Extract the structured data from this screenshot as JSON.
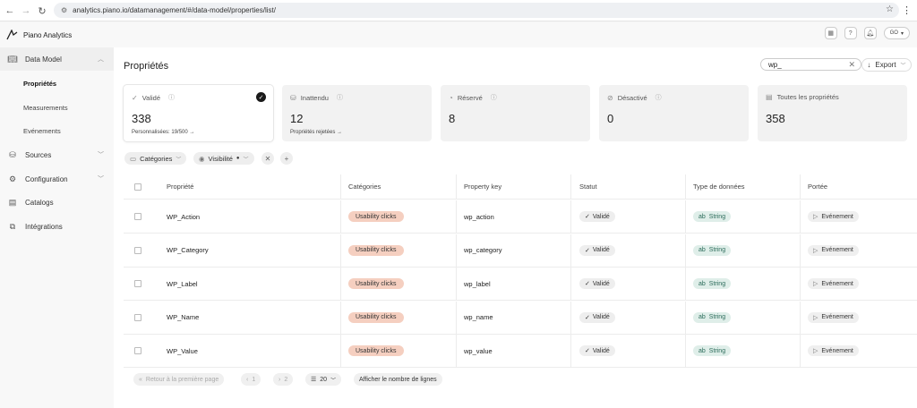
{
  "browser": {
    "url": "analytics.piano.io/datamanagement/#/data-model/properties/list/"
  },
  "app": {
    "name": "Piano Analytics",
    "user_initials": "GO"
  },
  "sidebar": {
    "items": [
      {
        "label": "Data Model",
        "icon": "book-icon"
      },
      {
        "label": "Propriétés"
      },
      {
        "label": "Measurements"
      },
      {
        "label": "Evénements"
      },
      {
        "label": "Sources",
        "icon": "sources-icon"
      },
      {
        "label": "Configuration",
        "icon": "gear-icon"
      },
      {
        "label": "Catalogs",
        "icon": "catalog-icon"
      },
      {
        "label": "Intégrations",
        "icon": "integrations-icon"
      }
    ]
  },
  "main": {
    "title": "Propriétés",
    "search_value": "wp_",
    "export_label": "Export"
  },
  "cards": [
    {
      "label": "Validé",
      "count": "338",
      "sub": "Personnalisées: 19/500  →"
    },
    {
      "label": "Inattendu",
      "count": "12",
      "sub": "Propriétés rejetées  →"
    },
    {
      "label": "Réservé",
      "count": "8"
    },
    {
      "label": "Désactivé",
      "count": "0"
    },
    {
      "label": "Toutes les propriétés",
      "count": "358"
    }
  ],
  "filters": {
    "categories": "Catégories",
    "visibility": "Visibilité"
  },
  "table": {
    "headers": [
      "Propriété",
      "Catégories",
      "Property key",
      "Statut",
      "Type de données",
      "Portée"
    ],
    "rows": [
      {
        "property": "WP_Action",
        "category": "Usability clicks",
        "key": "wp_action",
        "status": "Validé",
        "type": "String",
        "scope": "Evénement"
      },
      {
        "property": "WP_Category",
        "category": "Usability clicks",
        "key": "wp_category",
        "status": "Validé",
        "type": "String",
        "scope": "Evénement"
      },
      {
        "property": "WP_Label",
        "category": "Usability clicks",
        "key": "wp_label",
        "status": "Validé",
        "type": "String",
        "scope": "Evénement"
      },
      {
        "property": "WP_Name",
        "category": "Usability clicks",
        "key": "wp_name",
        "status": "Validé",
        "type": "String",
        "scope": "Evénement"
      },
      {
        "property": "WP_Value",
        "category": "Usability clicks",
        "key": "wp_value",
        "status": "Validé",
        "type": "String",
        "scope": "Evénement"
      }
    ],
    "type_prefix": "ab"
  },
  "pagination": {
    "first_page": "Retour à la première page",
    "page_prev": "1",
    "page_next": "2",
    "page_size": "20",
    "show_rows": "Afficher le nombre de lignes"
  },
  "colors": {
    "category_pill": "#f5cfc0",
    "type_pill": "#dfeee9",
    "type_text": "#2b6b5a"
  }
}
